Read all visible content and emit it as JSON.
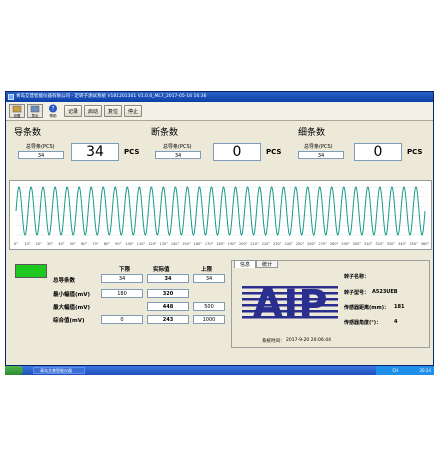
{
  "window": {
    "title": "青岛艾普智能仪器有限公司 - 定转子测试系统 V181201301 V1.0.0_ML7_2017-05-16 16:36"
  },
  "toolbar": {
    "icon1_label": "设置",
    "icon2_label": "导出",
    "icon3_label": "帮助",
    "record_label": "记录",
    "start_label": "启动",
    "reset_label": "复位",
    "stop_label": "停止"
  },
  "counters": [
    {
      "title": "导条数",
      "sub_label": "总导条(PCS)",
      "set_value": "34",
      "count": "34",
      "unit": "PCS"
    },
    {
      "title": "断条数",
      "sub_label": "总导条(PCS)",
      "set_value": "34",
      "count": "0",
      "unit": "PCS"
    },
    {
      "title": "细条数",
      "sub_label": "总导条(PCS)",
      "set_value": "34",
      "count": "0",
      "unit": "PCS"
    }
  ],
  "waveform": {
    "cycles": 34,
    "color": "#1a9a8a",
    "x_tick_labels": [
      "0°",
      "10°",
      "20°",
      "30°",
      "40°",
      "50°",
      "60°",
      "70°",
      "80°",
      "90°",
      "100°",
      "110°",
      "120°",
      "130°",
      "140°",
      "150°",
      "160°",
      "170°",
      "180°",
      "190°",
      "200°",
      "210°",
      "220°",
      "230°",
      "240°",
      "250°",
      "260°",
      "270°",
      "280°",
      "290°",
      "300°",
      "310°",
      "320°",
      "330°",
      "340°",
      "350°",
      "360°"
    ]
  },
  "measure_table": {
    "headers": {
      "lower": "下限",
      "actual": "实际值",
      "upper": "上限"
    },
    "rows": [
      {
        "label": "总导条数",
        "lower": "34",
        "actual": "34",
        "upper": "34"
      },
      {
        "label": "最小幅值(mV)",
        "lower": "180",
        "actual": "320",
        "upper": ""
      },
      {
        "label": "最大幅值(mV)",
        "lower": "",
        "actual": "448",
        "upper": "500"
      },
      {
        "label": "综合值(mV)",
        "lower": "0",
        "actual": "243",
        "upper": "1000"
      }
    ],
    "status_color": "#1ec81e"
  },
  "info_panel": {
    "tab_info": "信息",
    "tab_stats": "统计",
    "logo_text": "AIP",
    "rotor_name_label": "转子名称：",
    "rotor_name_value": "",
    "rotor_model_label": "转子型号：",
    "rotor_model_value": "A523UEB",
    "sensor_distance_label": "传感器距离(mm)：",
    "sensor_distance_value": "181",
    "sensor_angle_label": "传感器角度(°)：",
    "sensor_angle_value": "4",
    "time_label": "系统时间：",
    "time_value": "2017-9-20 20:06:44"
  },
  "taskbar": {
    "item_label": "青岛艾普智能仪器",
    "clock": "20:34",
    "tray_left": "CH"
  }
}
